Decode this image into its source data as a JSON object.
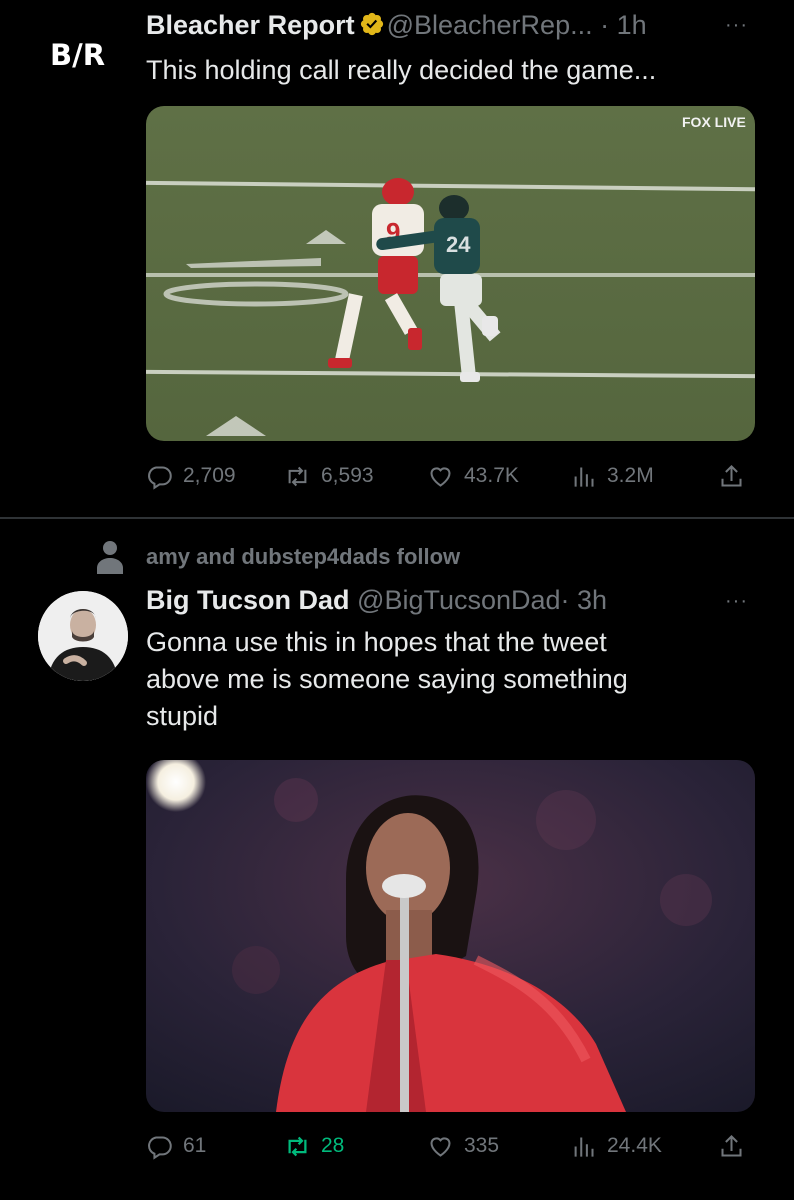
{
  "tweets": [
    {
      "author_logo": "B/R",
      "name": "Bleacher Report",
      "handle": "@BleacherRep...",
      "time": "· 1h",
      "verified": true,
      "text": "This holding call really decided the game...",
      "media_badge": "FOX LIVE",
      "stats": {
        "replies": "2,709",
        "retweets": "6,593",
        "likes": "43.7K",
        "views": "3.2M"
      }
    },
    {
      "social_context": "amy and dubstep4dads follow",
      "name": "Big Tucson Dad",
      "handle": "@BigTucsonDad",
      "time": "· 3h",
      "text_lines": [
        "Gonna use this in hopes that the tweet",
        "above me is someone saying something",
        "stupid"
      ],
      "stats": {
        "replies": "61",
        "retweets": "28",
        "likes": "335",
        "views": "24.4K"
      }
    }
  ],
  "ui": {
    "more_label": "···",
    "accent_green": "#00ba7c",
    "verified_gold": "#e2b719",
    "icons": [
      "reply-icon",
      "retweet-icon",
      "like-icon",
      "views-icon",
      "share-icon",
      "verified-icon",
      "more-icon",
      "person-icon"
    ]
  }
}
